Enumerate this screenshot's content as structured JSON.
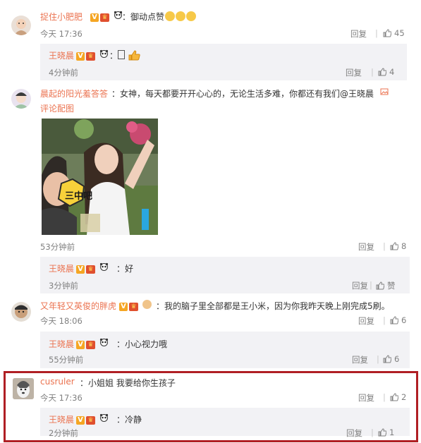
{
  "actions": {
    "reply": "回复",
    "sep": "|"
  },
  "comments": [
    {
      "user": "捉住小肥肥",
      "text": "：御动点赞",
      "time": "今天 17:36",
      "likes": "45",
      "reply": {
        "user": "王晓晨",
        "text": "：",
        "time": "4分钟前",
        "likes": "4"
      }
    },
    {
      "user": "晨起的阳光羞答答",
      "text": "：女神，每天都要开开心心的，无论生活多难，你都还有我们@王晓晨",
      "image_link": "评论配图",
      "time": "53分钟前",
      "likes": "8",
      "sticker_text": "三中吧",
      "reply": {
        "user": "王晓晨",
        "text": "：好",
        "time": "3分钟前",
        "likes": "赞"
      }
    },
    {
      "user": "又年轻又英俊的胖虎",
      "text": "：我的脑子里全部都是王小米，因为你我昨天晚上刚完成5刷。",
      "time": "今天 18:06",
      "likes": "6",
      "reply": {
        "user": "王晓晨",
        "text": "：小心视力哦",
        "time": "55分钟前",
        "likes": "6"
      }
    },
    {
      "user": "cusruler",
      "text": "：小姐姐 我要给你生孩子",
      "time": "今天 17:36",
      "likes": "2",
      "reply": {
        "user": "王晓晨",
        "text": "：冷静",
        "time": "2分钟前",
        "likes": "1"
      }
    }
  ],
  "colors": {
    "name": "#eb7350",
    "highlight": "#b01f24",
    "reply_bg": "#f2f2f5"
  }
}
